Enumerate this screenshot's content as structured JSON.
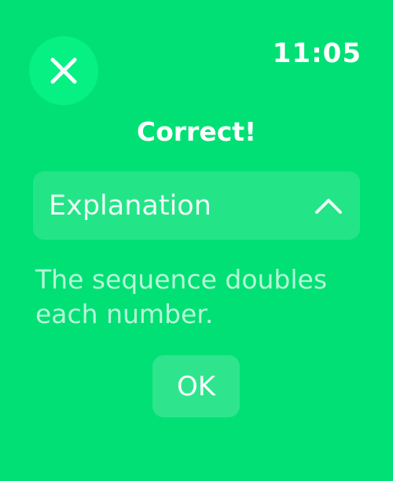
{
  "status_bar": {
    "time": "11:05"
  },
  "header": {
    "close_icon": "close-icon"
  },
  "result": {
    "title": "Correct!"
  },
  "explanation": {
    "toggle_label": "Explanation",
    "toggle_icon": "chevron-up-icon",
    "expanded": true,
    "text": "The sequence doubles each number."
  },
  "actions": {
    "ok_label": "OK"
  },
  "colors": {
    "background": "#00E075",
    "close_button": "#06F084",
    "text": "#FFFFFF"
  }
}
